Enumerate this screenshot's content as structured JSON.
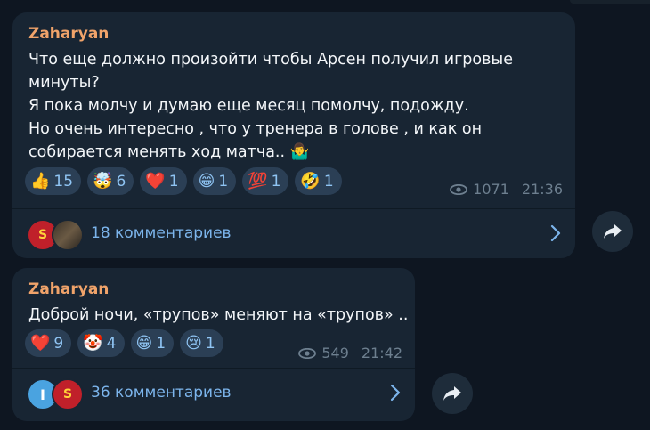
{
  "messages": [
    {
      "author": "Zaharyan",
      "text": "Что еще должно произойти чтобы Арсен получил игровые\nминуты?\nЯ пока молчу и думаю еще месяц помолчу, подожду.\nНо очень интересно , что у тренера в голове , и как он\nсобирается менять ход матча.. 🤷‍♂️",
      "reactions": [
        {
          "emoji": "👍",
          "count": "15"
        },
        {
          "emoji": "🤯",
          "count": "6"
        },
        {
          "emoji": "❤️",
          "count": "1"
        },
        {
          "emoji": "😁",
          "count": "1"
        },
        {
          "emoji": "💯",
          "count": "1"
        },
        {
          "emoji": "🤣",
          "count": "1"
        }
      ],
      "views": "1071",
      "time": "21:36",
      "comments_label": "18 комментариев"
    },
    {
      "author": "Zaharyan",
      "text": "Доброй ночи, «трупов» меняют на «трупов» ..",
      "reactions": [
        {
          "emoji": "❤️",
          "count": "9"
        },
        {
          "emoji": "🤡",
          "count": "4"
        },
        {
          "emoji": "😁",
          "count": "1"
        },
        {
          "emoji": "😢",
          "count": "1"
        }
      ],
      "views": "549",
      "time": "21:42",
      "comments_label": "36 комментариев",
      "avatar_letter": "I"
    }
  ],
  "icons": {
    "views": "eye-icon",
    "comments_chevron": "chevron-right-icon",
    "forward": "share-arrow-icon"
  },
  "colors": {
    "background": "#0e1621",
    "bubble": "#182533",
    "author": "#f0a36a",
    "link": "#7cb5ec",
    "reaction_bg": "#2b3f55",
    "meta": "#6d7f8f"
  }
}
